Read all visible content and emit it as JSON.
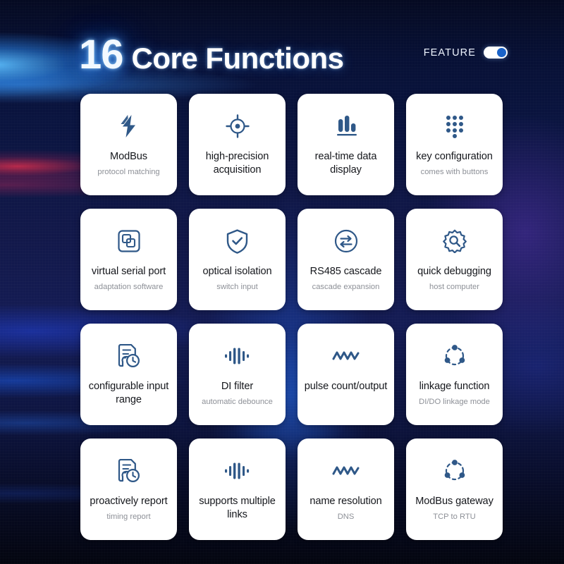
{
  "header": {
    "title_number": "16",
    "title_text": "Core Functions",
    "feature_label": "FEATURE",
    "toggle_state": "on"
  },
  "colors": {
    "icon": "#2f5888",
    "icon_light": "#3f6ea8",
    "card_bg": "#ffffff",
    "title_text": "#15171c",
    "sub_text": "#8d9097",
    "toggle_knob": "#1b63c8",
    "glow_blue": "#4aa3ff"
  },
  "cards": [
    {
      "icon": "lightning-bolt-icon",
      "title": "ModBus",
      "subtitle": "protocol matching"
    },
    {
      "icon": "crosshair-target-icon",
      "title": "high-precision acquisition",
      "subtitle": ""
    },
    {
      "icon": "bar-chart-icon",
      "title": "real-time data display",
      "subtitle": ""
    },
    {
      "icon": "keypad-dots-icon",
      "title": "key configuration",
      "subtitle": "comes with buttons"
    },
    {
      "icon": "overlapping-squares-icon",
      "title": "virtual serial port",
      "subtitle": "adaptation software"
    },
    {
      "icon": "shield-check-icon",
      "title": "optical isolation",
      "subtitle": "switch input"
    },
    {
      "icon": "transfer-arrows-icon",
      "title": "RS485 cascade",
      "subtitle": "cascade expansion"
    },
    {
      "icon": "gear-search-icon",
      "title": "quick debugging",
      "subtitle": "host computer"
    },
    {
      "icon": "document-clock-icon",
      "title": "configurable input range",
      "subtitle": ""
    },
    {
      "icon": "waveform-bars-icon",
      "title": "DI filter",
      "subtitle": "automatic debounce"
    },
    {
      "icon": "zigzag-wave-icon",
      "title": "pulse count/output",
      "subtitle": ""
    },
    {
      "icon": "share-nodes-icon",
      "title": "linkage function",
      "subtitle": "DI/DO linkage mode"
    },
    {
      "icon": "document-clock-icon",
      "title": "proactively report",
      "subtitle": "timing report"
    },
    {
      "icon": "waveform-bars-icon",
      "title": "supports multiple links",
      "subtitle": ""
    },
    {
      "icon": "zigzag-wave-icon",
      "title": "name resolution",
      "subtitle": "DNS"
    },
    {
      "icon": "share-nodes-icon",
      "title": "ModBus gateway",
      "subtitle": "TCP to RTU"
    }
  ]
}
